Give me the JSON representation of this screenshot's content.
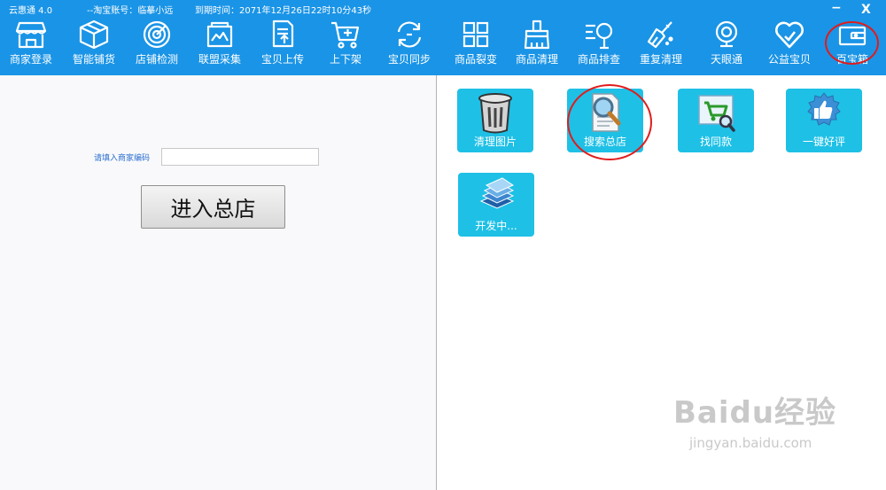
{
  "titlebar": {
    "app_name": "云惠通  4.0",
    "account": "--淘宝账号：临摹小远",
    "expiry": "到期时间：2071年12月26日22时10分43秒",
    "minimize": "−",
    "close": "X"
  },
  "toolbar": {
    "items": [
      {
        "label": "商家登录",
        "icon": "shop-icon"
      },
      {
        "label": "智能铺货",
        "icon": "box-icon"
      },
      {
        "label": "店铺检测",
        "icon": "radar-icon"
      },
      {
        "label": "联盟采集",
        "icon": "image-collect-icon"
      },
      {
        "label": "宝贝上传",
        "icon": "upload-doc-icon"
      },
      {
        "label": "上下架",
        "icon": "cart-icon"
      },
      {
        "label": "宝贝同步",
        "icon": "sync-icon"
      },
      {
        "label": "商品裂变",
        "icon": "grid-icon"
      },
      {
        "label": "商品清理",
        "icon": "brush-icon"
      },
      {
        "label": "商品排查",
        "icon": "search-list-icon"
      },
      {
        "label": "重复清理",
        "icon": "broom-icon"
      },
      {
        "label": "天眼通",
        "icon": "webcam-icon"
      },
      {
        "label": "公益宝贝",
        "icon": "heart-icon"
      },
      {
        "label": "百宝箱",
        "icon": "wallet-icon"
      }
    ]
  },
  "left_pane": {
    "code_label": "请填入商家编码",
    "code_value": "",
    "enter_button": "进入总店"
  },
  "tiles": [
    {
      "label": "清理图片",
      "icon": "trash-icon"
    },
    {
      "label": "搜索总店",
      "icon": "magnifier-icon"
    },
    {
      "label": "找同款",
      "icon": "cart-search-icon"
    },
    {
      "label": "一键好评",
      "icon": "thumbs-up-icon"
    },
    {
      "label": "开发中...",
      "icon": "stack-icon"
    }
  ],
  "watermark": {
    "brand": "Baidu经验",
    "url": "jingyan.baidu.com"
  },
  "colors": {
    "toolbar_bg": "#1a94e6",
    "tile_bg": "#1ec0e6",
    "highlight_ring": "#e01c1c"
  }
}
